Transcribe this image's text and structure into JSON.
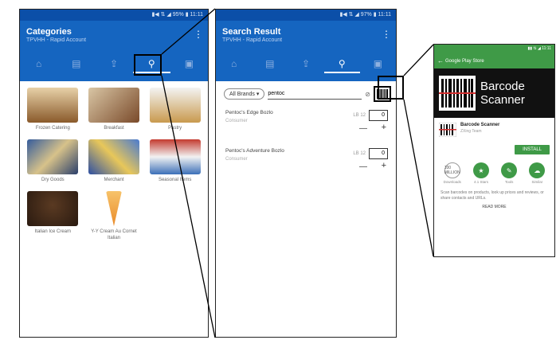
{
  "categories_screen": {
    "status": "▮◀ ⇅ ◢ 95% ▮ 11:11",
    "title": "Categories",
    "subtitle": "TPVHH - Rapid Account",
    "tabs": [
      "home-icon",
      "catalog-icon",
      "upload-icon",
      "search-icon",
      "cart-icon"
    ],
    "items": [
      {
        "label": "Frozen Catering"
      },
      {
        "label": "Breakfast"
      },
      {
        "label": "Pastry"
      },
      {
        "label": "Dry Goods"
      },
      {
        "label": "Merchant"
      },
      {
        "label": "Seasonal Items"
      },
      {
        "label": "Italian Ice Cream"
      },
      {
        "label": "Y-Y Cream Au Cornet Italian"
      }
    ]
  },
  "search_screen": {
    "status": "▮◀ ⇅ ◢ 97% ▮ 11:11",
    "title": "Search Result",
    "subtitle": "TPVHH - Rapid Account",
    "brand_filter": "All Brands",
    "query": "pentoc",
    "results": [
      {
        "name": "Pentoc's Edge Bozlo",
        "sub": "Consumer",
        "unit": "LB 12",
        "qty": "0"
      },
      {
        "name": "Pentoc's Adventure Bozlo",
        "sub": "Consumer",
        "unit": "LB 12",
        "qty": "0"
      }
    ]
  },
  "play_store": {
    "status": "▮▮ ⇅ ◢ 11:11",
    "header": "Google Play Store",
    "banner_line1": "Barcode",
    "banner_line2": "Scanner",
    "app_name": "Barcode Scanner",
    "developer": "ZXing Team",
    "install_label": "INSTALL",
    "badges": [
      {
        "icon": "downloads-icon",
        "text": "100 MILLION",
        "label": "Downloads"
      },
      {
        "icon": "rating-icon",
        "text": "★",
        "label": "4.1 Stars"
      },
      {
        "icon": "category-icon",
        "text": "✎",
        "label": "Tools"
      },
      {
        "icon": "similar-icon",
        "text": "☁",
        "label": "Similar"
      }
    ],
    "description": "Scan barcodes on products, look up prices and reviews, or share contacts and URLs.",
    "read_more": "READ MORE"
  },
  "colors": {
    "appbar": "#1565c0",
    "statusbar": "#0b4fa8",
    "play_green": "#3f9a47"
  }
}
